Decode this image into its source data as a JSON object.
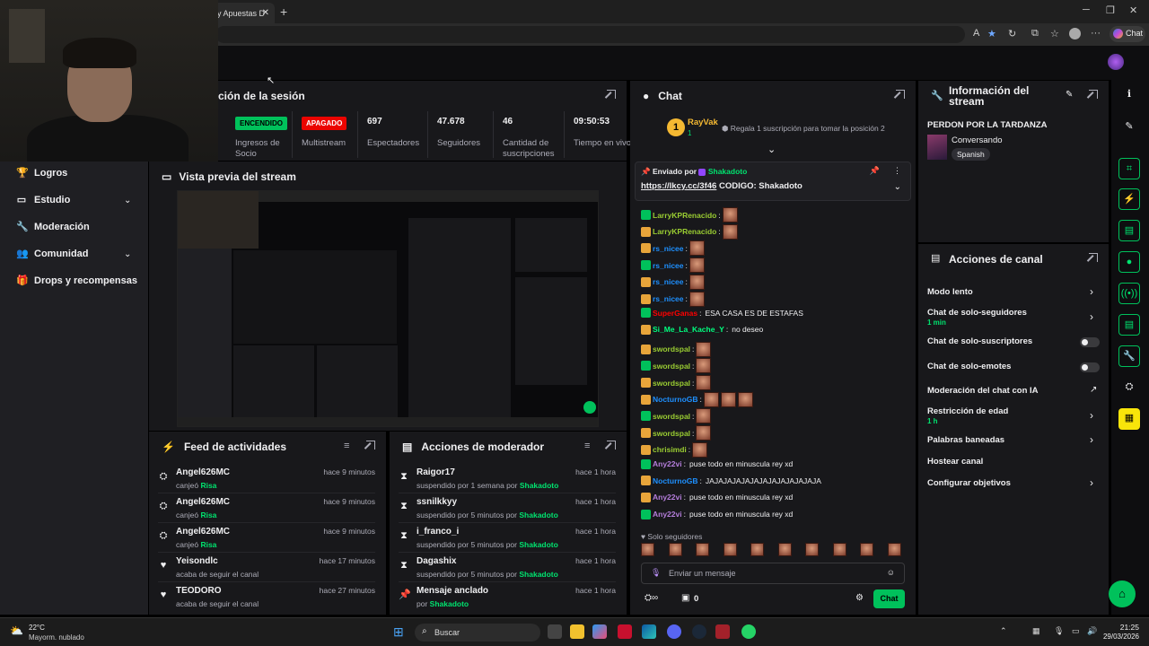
{
  "browser": {
    "tab_title": "y Apuestas D",
    "tab_close": "✕",
    "new_tab": "+",
    "copilot_label": "Chat"
  },
  "session": {
    "title": "ción de la sesión",
    "stats": [
      {
        "value": "ENCENDIDO",
        "label": "Ingresos de Socio"
      },
      {
        "value": "APAGADO",
        "label": "Multistream"
      },
      {
        "value": "697",
        "label": "Espectadores"
      },
      {
        "value": "47.678",
        "label": "Seguidores"
      },
      {
        "value": "46",
        "label": "Cantidad de suscripciones"
      },
      {
        "value": "09:50:53",
        "label": "Tiempo en vivo"
      }
    ]
  },
  "leftnav": {
    "items": [
      {
        "label": "Logros",
        "icon": "trophy-icon"
      },
      {
        "label": "Estudio",
        "icon": "video-icon"
      },
      {
        "label": "Moderación",
        "icon": "wrench-icon"
      },
      {
        "label": "Comunidad",
        "icon": "people-icon"
      },
      {
        "label": "Drops y recompensas",
        "icon": "gift-icon"
      }
    ]
  },
  "preview": {
    "title": "Vista previa del stream"
  },
  "feed": {
    "title": "Feed de actividades",
    "rows": [
      {
        "name": "Angel626MC",
        "sub": "canjeó",
        "highlight": "Risa",
        "time": "hace 9 minutos",
        "icon": "points-icon"
      },
      {
        "name": "Angel626MC",
        "sub": "canjeó",
        "highlight": "Risa",
        "time": "hace 9 minutos",
        "icon": "points-icon"
      },
      {
        "name": "Angel626MC",
        "sub": "canjeó",
        "highlight": "Risa",
        "time": "hace 9 minutos",
        "icon": "points-icon"
      },
      {
        "name": "Yeisondlc",
        "sub": "acaba de seguir el canal",
        "highlight": "",
        "time": "hace 17 minutos",
        "icon": "heart-icon"
      },
      {
        "name": "TEODORO",
        "sub": "acaba de seguir el canal",
        "highlight": "",
        "time": "hace 27 minutos",
        "icon": "heart-icon"
      }
    ]
  },
  "modactions": {
    "title": "Acciones de moderador",
    "rows": [
      {
        "name": "Raigor17",
        "sub": "suspendido por 1 semana por",
        "highlight": "Shakadoto",
        "time": "hace 1 hora",
        "icon": "hourglass-icon"
      },
      {
        "name": "ssnilkkyy",
        "sub": "suspendido por 5 minutos por",
        "highlight": "Shakadoto",
        "time": "hace 1 hora",
        "icon": "hourglass-icon"
      },
      {
        "name": "i_franco_i",
        "sub": "suspendido por 5 minutos por",
        "highlight": "Shakadoto",
        "time": "hace 1 hora",
        "icon": "hourglass-icon"
      },
      {
        "name": "Dagashix",
        "sub": "suspendido por 5 minutos por",
        "highlight": "Shakadoto",
        "time": "hace 1 hora",
        "icon": "hourglass-icon"
      },
      {
        "name": "Mensaje anclado",
        "sub": "por",
        "highlight": "Shakadoto",
        "time": "hace 1 hora",
        "icon": "pin-icon"
      }
    ]
  },
  "chat": {
    "title": "Chat",
    "top_gifter": "RayVak",
    "top_gifter_count": "1",
    "gift_prompt": "Regala 1 suscripción para tomar la posición 2",
    "pinned_by_label": "Enviado por",
    "pinned_by": "Shakadoto",
    "pinned_link": "https://lkcy.cc/3f46",
    "pinned_text": "CODIGO: Shakadoto",
    "messages": [
      {
        "user": "LarryKPRenacido",
        "color": "#9acd32",
        "text": "",
        "emotes": 1
      },
      {
        "user": "LarryKPRenacido",
        "color": "#9acd32",
        "text": "",
        "emotes": 1
      },
      {
        "user": "rs_nicee",
        "color": "#1e90ff",
        "text": "",
        "emotes": 1
      },
      {
        "user": "rs_nicee",
        "color": "#1e90ff",
        "text": "",
        "emotes": 1
      },
      {
        "user": "rs_nicee",
        "color": "#1e90ff",
        "text": "",
        "emotes": 1
      },
      {
        "user": "rs_nicee",
        "color": "#1e90ff",
        "text": "",
        "emotes": 1
      },
      {
        "user": "SuperGanas",
        "color": "#ff0000",
        "text": "ESA CASA ES DE ESTAFAS",
        "emotes": 0
      },
      {
        "user": "Si_Me_La_Kache_Y",
        "color": "#00ff7f",
        "text": "no deseo",
        "emotes": 0
      },
      {
        "user": "swordspal",
        "color": "#9acd32",
        "text": "",
        "emotes": 1
      },
      {
        "user": "swordspal",
        "color": "#9acd32",
        "text": "",
        "emotes": 1
      },
      {
        "user": "swordspal",
        "color": "#9acd32",
        "text": "",
        "emotes": 1
      },
      {
        "user": "NocturnoGB",
        "color": "#1e90ff",
        "text": "",
        "emotes": 3
      },
      {
        "user": "swordspal",
        "color": "#9acd32",
        "text": "",
        "emotes": 1
      },
      {
        "user": "swordspal",
        "color": "#9acd32",
        "text": "",
        "emotes": 1
      },
      {
        "user": "chrisimdi",
        "color": "#9acd32",
        "text": "",
        "emotes": 1
      },
      {
        "user": "Any22vi",
        "color": "#b57edc",
        "text": "puse todo en minuscula rey xd",
        "emotes": 0
      },
      {
        "user": "NocturnoGB",
        "color": "#1e90ff",
        "text": "JAJAJAJAJAJAJAJAJAJAJAJAJA",
        "emotes": 0
      },
      {
        "user": "Any22vi",
        "color": "#b57edc",
        "text": "puse todo en minuscula rey xd",
        "emotes": 0
      },
      {
        "user": "Any22vi",
        "color": "#b57edc",
        "text": "puse todo en minuscula rey xd",
        "emotes": 0
      }
    ],
    "followers_only": "Solo seguidores",
    "input_placeholder": "Enviar un mensaje",
    "points": "0",
    "send_label": "Chat"
  },
  "streaminfo": {
    "title": "Información del stream",
    "stream_title": "PERDON POR LA TARDANZA",
    "category": "Conversando",
    "tag": "Spanish"
  },
  "channelactions": {
    "title": "Acciones de canal",
    "rows": [
      {
        "label": "Modo lento",
        "sub": "",
        "control": "chevron"
      },
      {
        "label": "Chat de solo-seguidores",
        "sub": "1 min",
        "control": "chevron"
      },
      {
        "label": "Chat de solo-suscriptores",
        "sub": "",
        "control": "toggle"
      },
      {
        "label": "Chat de solo-emotes",
        "sub": "",
        "control": "toggle"
      },
      {
        "label": "Moderación del chat con IA",
        "sub": "",
        "control": "external"
      },
      {
        "label": "Restricción de edad",
        "sub": "1 h",
        "control": "chevron"
      },
      {
        "label": "Palabras baneadas",
        "sub": "",
        "control": "chevron"
      },
      {
        "label": "Hostear canal",
        "sub": "",
        "control": "none"
      },
      {
        "label": "Configurar objetivos",
        "sub": "",
        "control": "chevron"
      }
    ]
  },
  "taskbar": {
    "weather_temp": "22°C",
    "weather_desc": "Mayorm. nublado",
    "search": "Buscar",
    "time": "21:25",
    "date": "29/03/2026"
  }
}
